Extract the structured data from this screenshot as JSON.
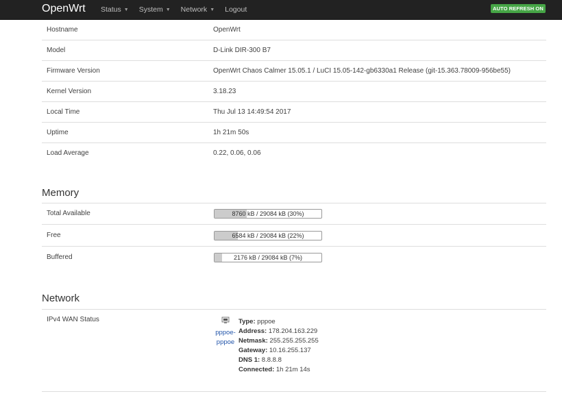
{
  "navbar": {
    "brand": "OpenWrt",
    "menu": [
      {
        "label": "Status",
        "has_dropdown": true
      },
      {
        "label": "System",
        "has_dropdown": true
      },
      {
        "label": "Network",
        "has_dropdown": true
      },
      {
        "label": "Logout",
        "has_dropdown": false
      }
    ],
    "auto_refresh_badge": "AUTO REFRESH ON",
    "badge_color": "#46a546"
  },
  "system": [
    {
      "label": "Hostname",
      "value": "OpenWrt"
    },
    {
      "label": "Model",
      "value": "D-Link DIR-300 B7"
    },
    {
      "label": "Firmware Version",
      "value": "OpenWrt Chaos Calmer 15.05.1 / LuCI 15.05-142-gb6330a1 Release (git-15.363.78009-956be55)"
    },
    {
      "label": "Kernel Version",
      "value": "3.18.23"
    },
    {
      "label": "Local Time",
      "value": "Thu Jul 13 14:49:54 2017"
    },
    {
      "label": "Uptime",
      "value": "1h 21m 50s"
    },
    {
      "label": "Load Average",
      "value": "0.22, 0.06, 0.06"
    }
  ],
  "memory": {
    "title": "Memory",
    "rows": [
      {
        "label": "Total Available",
        "text": "8760 kB / 29084 kB (30%)",
        "percent": 30
      },
      {
        "label": "Free",
        "text": "6584 kB / 29084 kB (22%)",
        "percent": 22
      },
      {
        "label": "Buffered",
        "text": "2176 kB / 29084 kB (7%)",
        "percent": 7
      }
    ]
  },
  "network": {
    "title": "Network",
    "wan_label": "IPv4 WAN Status",
    "iface_line1": "pppoe-",
    "iface_line2": "pppoe",
    "icon": "ethernet-port-icon",
    "fields": [
      {
        "key": "Type:",
        "value": "pppoe"
      },
      {
        "key": "Address:",
        "value": "178.204.163.229"
      },
      {
        "key": "Netmask:",
        "value": "255.255.255.255"
      },
      {
        "key": "Gateway:",
        "value": "10.16.255.137"
      },
      {
        "key": "DNS 1:",
        "value": "8.8.8.8"
      },
      {
        "key": "Connected:",
        "value": "1h 21m 14s"
      }
    ]
  }
}
